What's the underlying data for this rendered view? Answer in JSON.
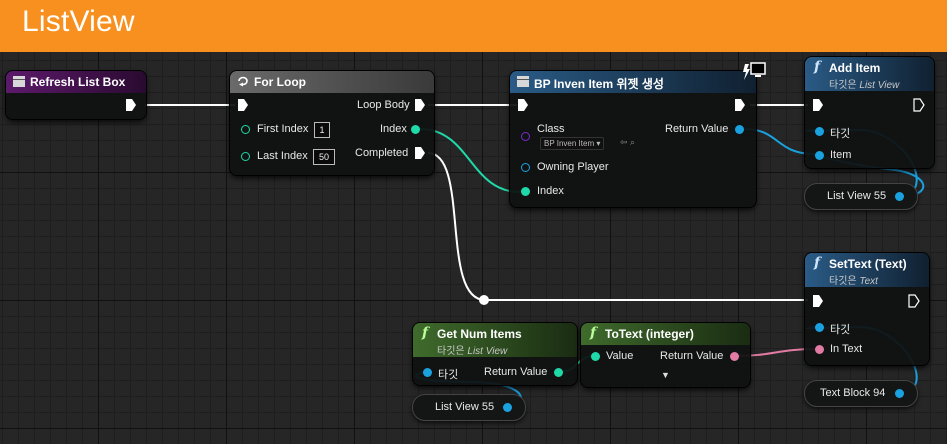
{
  "title": "ListView",
  "nodes": {
    "refresh": {
      "title": "Refresh List Box"
    },
    "forloop": {
      "title": "For Loop",
      "first_index_label": "First Index",
      "first_index_value": "1",
      "last_index_label": "Last Index",
      "last_index_value": "50",
      "loop_body": "Loop Body",
      "index": "Index",
      "completed": "Completed"
    },
    "create": {
      "title": "BP Inven Item 위젯 생성",
      "class_label": "Class",
      "class_value": "BP Inven Item",
      "owning_player": "Owning Player",
      "index": "Index",
      "return_value": "Return Value"
    },
    "additem": {
      "title": "Add Item",
      "target_prefix": "타깃은",
      "target_name": "List View",
      "target_pin": "타깃",
      "item_pin": "Item"
    },
    "settext": {
      "title": "SetText (Text)",
      "target_prefix": "타깃은",
      "target_name": "Text",
      "target_pin": "타깃",
      "in_text": "In Text"
    },
    "getnum": {
      "title": "Get Num Items",
      "target_prefix": "타깃은",
      "target_name": "List View",
      "target_pin": "타깃",
      "return_value": "Return Value"
    },
    "totext": {
      "title": "ToText (integer)",
      "value": "Value",
      "return_value": "Return Value"
    }
  },
  "variables": {
    "listview_a": "List View 55",
    "textblock": "Text Block 94",
    "listview_b": "List View 55"
  },
  "colors": {
    "title_bar": "#f7901e",
    "exec": "#ffffff",
    "object": "#1aa2e0",
    "int": "#1fd9a8",
    "text": "#e17ba4",
    "class": "#7a2ad0",
    "event_header": "#5c1a6a",
    "func_header": "#2a5b86",
    "pure_header": "#3f6b2c",
    "macro_header": "#505050"
  }
}
